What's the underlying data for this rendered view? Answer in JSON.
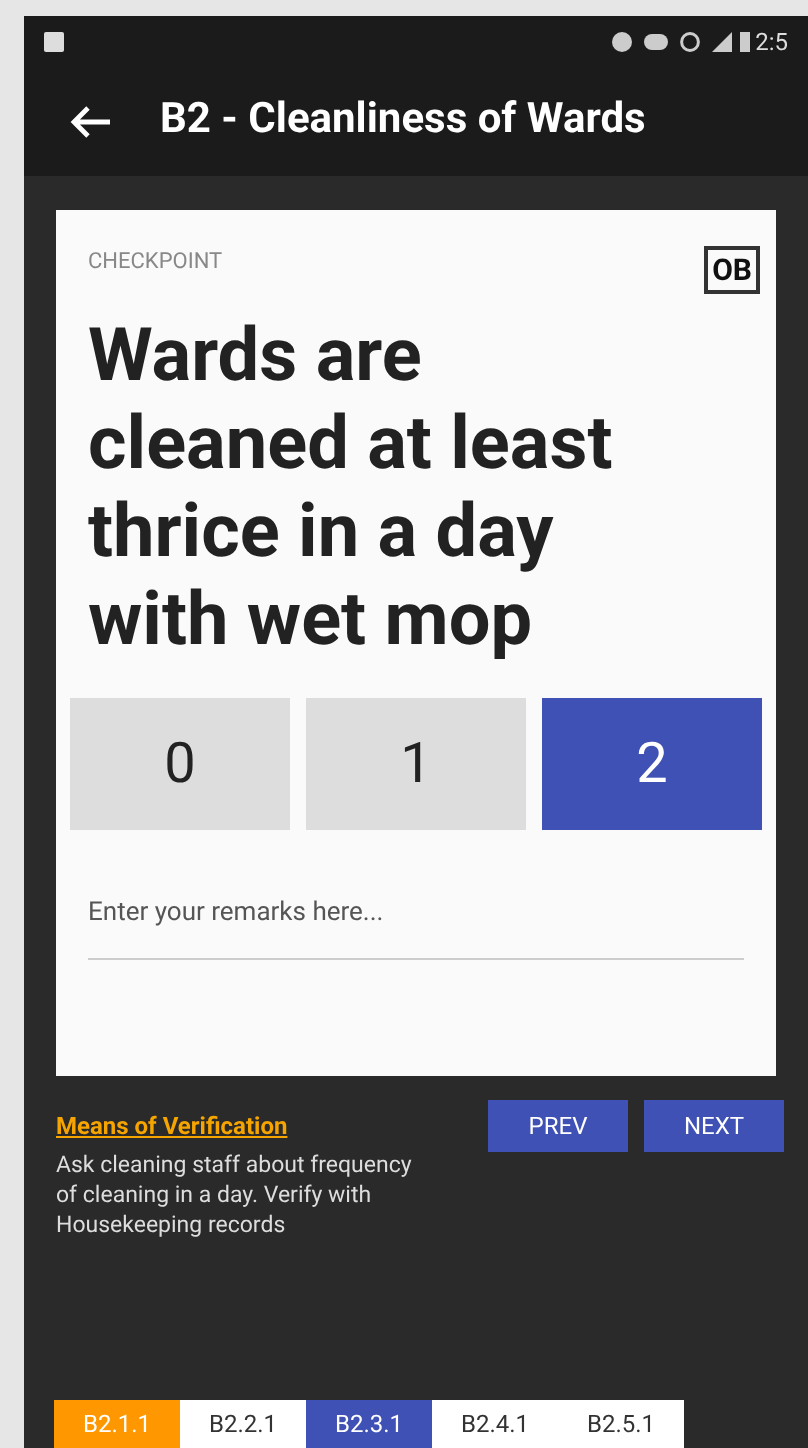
{
  "status_bar": {
    "time": "2:5"
  },
  "app_bar": {
    "title": "B2 - Cleanliness of Wards"
  },
  "card": {
    "label": "CHECKPOINT",
    "badge": "OB",
    "question": "Wards are cleaned at least thrice in a day with wet mop",
    "scores": [
      {
        "label": "0",
        "selected": false
      },
      {
        "label": "1",
        "selected": false
      },
      {
        "label": "2",
        "selected": true
      }
    ],
    "remarks": {
      "placeholder": "Enter your remarks here..."
    }
  },
  "verification": {
    "title": "Means of Verification",
    "text": "Ask cleaning staff about frequency of cleaning in a day. Verify with Housekeeping records"
  },
  "buttons": [
    "PREV",
    "NEXT"
  ],
  "tabs": [
    {
      "label": "B2.1.1",
      "color": "#ff9800"
    },
    {
      "label": "B2.2.1",
      "color": "#ffffff"
    },
    {
      "label": "B2.3.1",
      "color": "#3f51b5"
    },
    {
      "label": "B2.4.1",
      "color": "#ffffff"
    },
    {
      "label": "B2.5.1",
      "color": "#ffffff"
    }
  ]
}
